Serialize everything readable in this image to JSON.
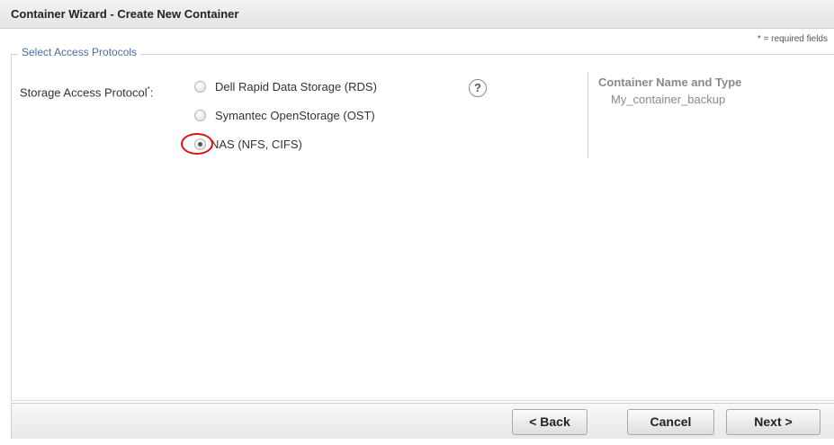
{
  "window": {
    "title": "Container Wizard - Create New Container"
  },
  "form": {
    "required_note": "* = required fields",
    "section_title": "Select Access Protocols",
    "protocol_label": "Storage Access Protocol",
    "protocol_label_suffix": ":",
    "required_marker": "*",
    "options": [
      {
        "label": "Dell Rapid Data Storage (RDS)",
        "selected": false
      },
      {
        "label": "Symantec OpenStorage (OST)",
        "selected": false
      },
      {
        "label": "NAS (NFS, CIFS)",
        "selected": true
      }
    ],
    "help_glyph": "?",
    "help_icon": "help-icon",
    "highlight_color": "#d9151b"
  },
  "summary": {
    "title": "Container Name and Type",
    "value": "My_container_backup"
  },
  "footer": {
    "back_label": "< Back",
    "cancel_label": "Cancel",
    "next_label": "Next >"
  }
}
